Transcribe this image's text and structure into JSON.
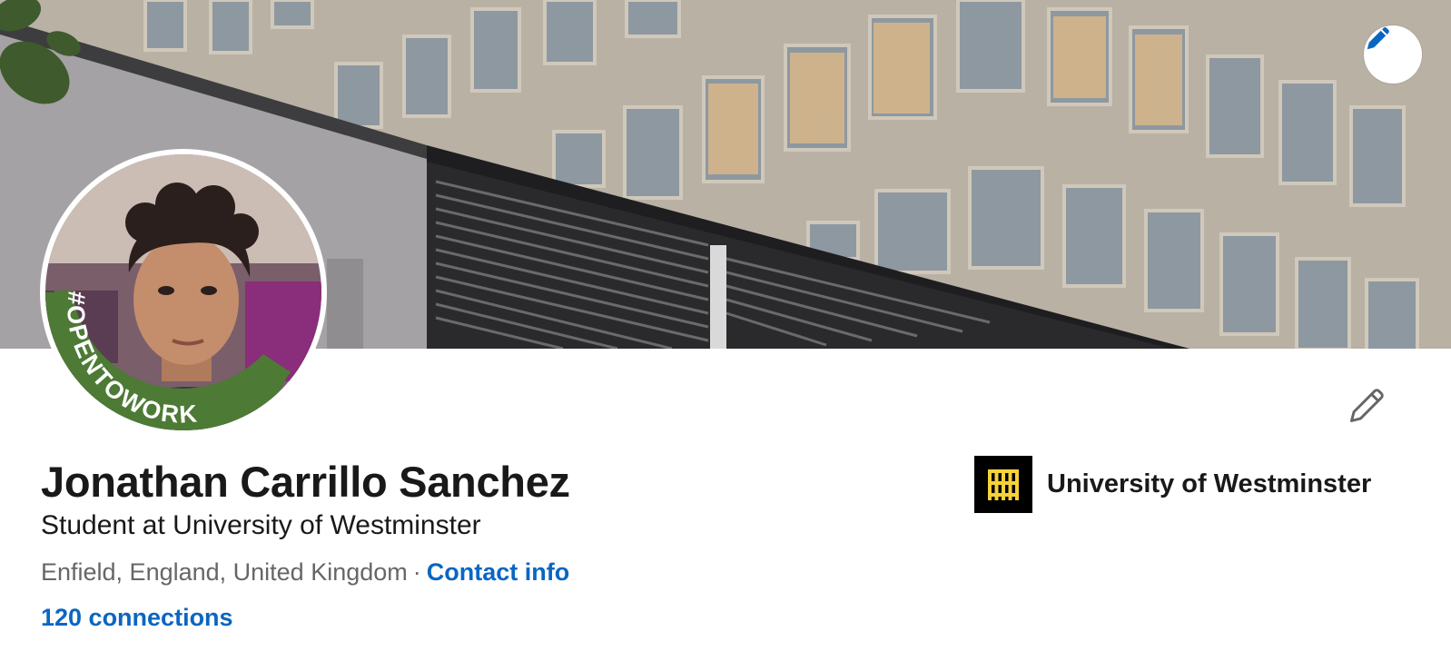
{
  "profile": {
    "name": "Jonathan Carrillo Sanchez",
    "headline": "Student at University of Westminster",
    "location": "Enfield, England, United Kingdom",
    "separator": "·",
    "contact_info_label": "Contact info",
    "connections_label": "120 connections",
    "open_to_work_badge": "#OPENTOWORK"
  },
  "education": {
    "name": "University of Westminster"
  },
  "icons": {
    "cover_edit": "pencil-icon",
    "profile_edit": "pencil-icon",
    "education_logo": "university-westminster-logo"
  },
  "colors": {
    "link": "#0a66c2",
    "open_to_work_green": "#4d7a35",
    "text_primary": "#191919",
    "text_secondary": "#666666",
    "edu_logo_bg": "#000000",
    "edu_logo_fg": "#f5d23a"
  }
}
